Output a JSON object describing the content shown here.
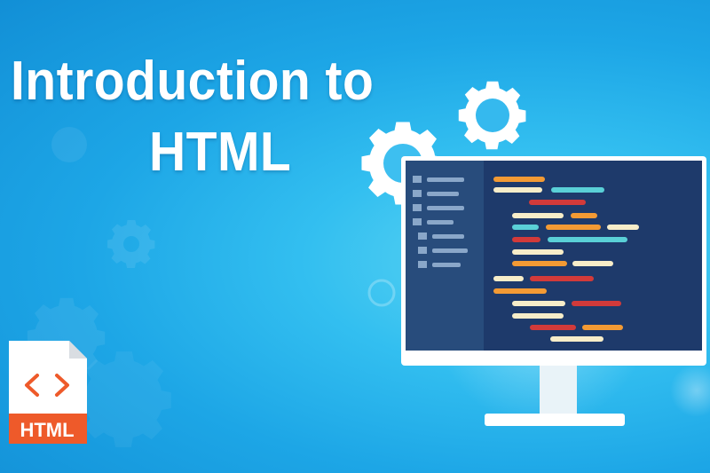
{
  "title": {
    "line1": "Introduction to",
    "line2": "HTML"
  },
  "file_icon": {
    "label": "HTML",
    "icon": "html-file-icon"
  },
  "colors": {
    "background": "#1da6e6",
    "monitor_screen": "#1e3a6b",
    "monitor_sidebar": "#2a4d7d",
    "code_orange": "#f39a34",
    "code_teal": "#5ad0d7",
    "code_red": "#d23a3a",
    "code_cream": "#f7edc9",
    "file_badge": "#ee5a2a"
  },
  "icons": [
    "gear-icon",
    "monitor-icon",
    "html-file-icon",
    "code-brackets-icon"
  ]
}
